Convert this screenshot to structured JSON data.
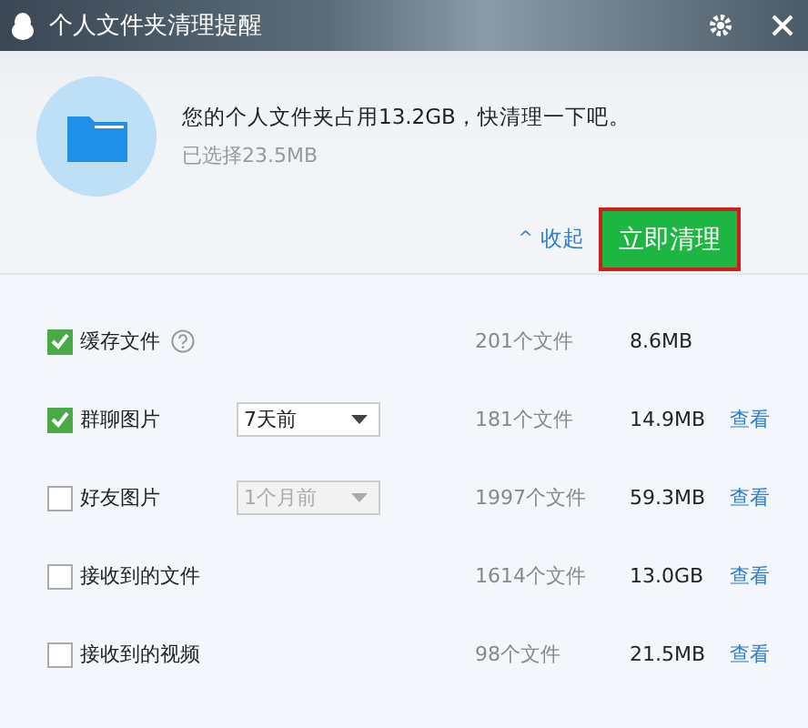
{
  "window": {
    "title": "个人文件夹清理提醒"
  },
  "summary": {
    "message": "您的个人文件夹占用13.2GB，快清理一下吧。",
    "selected": "已选择23.5MB",
    "collapse": "收起",
    "collapse_arrow": "^",
    "clean_button": "立即清理"
  },
  "items": [
    {
      "kind": "help",
      "label": "缓存文件",
      "checked": true,
      "count": "201个文件",
      "size": "8.6MB"
    },
    {
      "kind": "select",
      "label": "群聊图片",
      "checked": true,
      "period": "7天前",
      "disabled": false,
      "count": "181个文件",
      "size": "14.9MB",
      "view": "查看"
    },
    {
      "kind": "select",
      "label": "好友图片",
      "checked": false,
      "period": "1个月前",
      "disabled": true,
      "count": "1997个文件",
      "size": "59.3MB",
      "view": "查看"
    },
    {
      "kind": "plain",
      "label": "接收到的文件",
      "checked": false,
      "count": "1614个文件",
      "size": "13.0GB",
      "view": "查看"
    },
    {
      "kind": "plain",
      "label": "接收到的视频",
      "checked": false,
      "count": "98个文件",
      "size": "21.5MB",
      "view": "查看"
    }
  ]
}
